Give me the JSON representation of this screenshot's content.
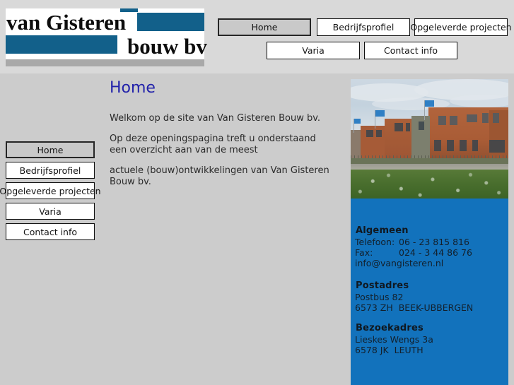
{
  "site": {
    "logo": {
      "word_1": "van Gisteren",
      "word_2": "bouw bv",
      "bar_color": "#12608a"
    },
    "colors": {
      "header_bg": "#d9d9d9",
      "page_bg": "#cccccc",
      "logo_blue": "#12608a",
      "panel_blue": "#1272bc",
      "heading_blue": "#2222aa",
      "button_bg": "#ffffff",
      "button_active_bg": "#c9c9c9",
      "logo_underbar": "#a9a9a9"
    }
  },
  "topnav": {
    "row_1": [
      {
        "label": "Home",
        "active": true
      },
      {
        "label": "Bedrijfsprofiel",
        "active": false
      },
      {
        "label": "Opgeleverde projecten",
        "active": false
      }
    ],
    "row_2": [
      {
        "label": "Varia",
        "active": false
      },
      {
        "label": "Contact info",
        "active": false
      }
    ]
  },
  "sidebar": {
    "items": [
      {
        "label": "Home",
        "active": true
      },
      {
        "label": "Bedrijfsprofiel",
        "active": false
      },
      {
        "label": "Opgeleverde projecten",
        "active": false
      },
      {
        "label": "Varia",
        "active": false
      },
      {
        "label": "Contact info",
        "active": false
      }
    ]
  },
  "main": {
    "title": "Home",
    "paragraphs": [
      "Welkom op de site van Van Gisteren Bouw bv.",
      "Op deze openingspagina treft u onderstaand een overzicht aan van de meest",
      "actuele (bouw)ontwikkelingen van Van Gisteren Bouw bv."
    ]
  },
  "photo": {
    "alt": "Bedrijfsgebouw van Van Gisteren Bouw bv met grasveld op de voorgrond"
  },
  "contact": {
    "algemeen": {
      "heading": "Algemeen",
      "telefoon_label": "Telefoon:",
      "telefoon_value": "06 - 23 815 816",
      "fax_label": "Fax:",
      "fax_value": "024 - 3 44 86 76",
      "email": "info@vangisteren.nl"
    },
    "postadres": {
      "heading": "Postadres",
      "line_1": "Postbus 82",
      "line_2": "6573 ZH  BEEK-UBBERGEN"
    },
    "bezoekadres": {
      "heading": "Bezoekadres",
      "line_1": "Lieskes Wengs 3a",
      "line_2": "6578 JK  LEUTH"
    }
  }
}
